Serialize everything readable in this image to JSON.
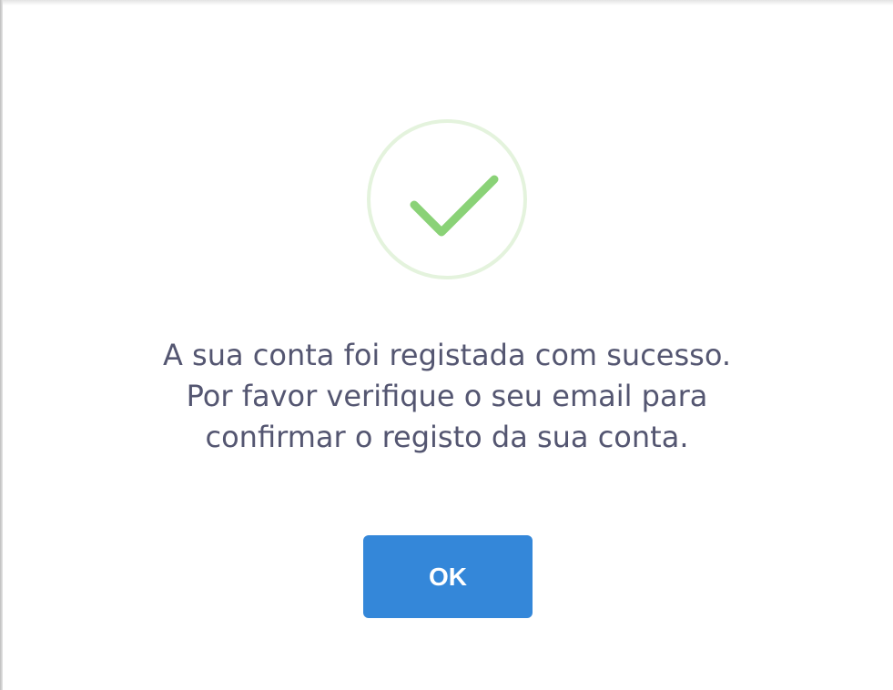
{
  "dialog": {
    "icon": "success-checkmark-icon",
    "message_lines": [
      "A sua conta foi registada com sucesso.",
      "Por favor verifique o seu email para",
      "confirmar o registo da sua conta."
    ],
    "ok_label": "OK"
  },
  "colors": {
    "icon_ring": "#e4f3dd",
    "checkmark": "#8ad277",
    "message_text": "#545671",
    "button_background": "#3487d9",
    "button_text": "#ffffff"
  }
}
